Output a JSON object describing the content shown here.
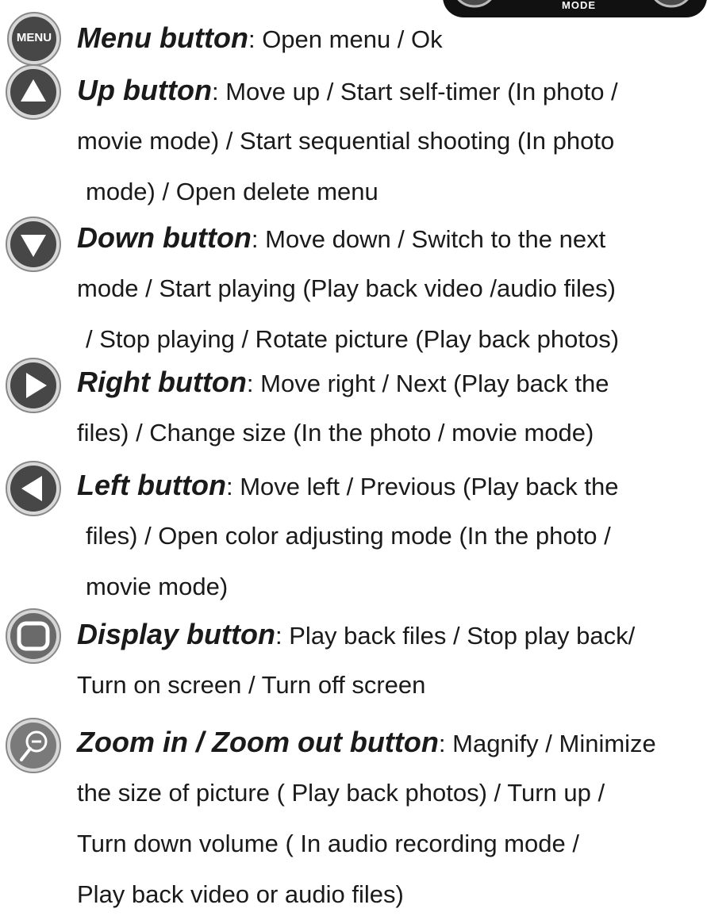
{
  "top_fragment": {
    "label": "MODE"
  },
  "entries": [
    {
      "icon": "menu-button-icon",
      "icon_text": "MENU",
      "title": "Menu button",
      "sep": ":",
      "lines": [
        "Open menu / Ok"
      ]
    },
    {
      "icon": "up-arrow-button-icon",
      "title": "Up button",
      "sep": ":",
      "lines": [
        "Move up / Start self-timer (In photo /",
        "movie mode) / Start sequential shooting (In photo",
        "mode) / Open delete menu"
      ]
    },
    {
      "icon": "down-arrow-button-icon",
      "title": "Down button",
      "sep": ":",
      "lines": [
        "Move down / Switch to the next",
        "mode / Start playing (Play back video /audio files)",
        "/ Stop playing / Rotate picture (Play back photos)"
      ]
    },
    {
      "icon": "right-arrow-button-icon",
      "title": "Right button",
      "sep": ":",
      "lines": [
        "Move right / Next (Play back the",
        "files) / Change size (In the photo / movie mode)"
      ]
    },
    {
      "icon": "left-arrow-button-icon",
      "title": "Left button",
      "sep": ":",
      "lines": [
        "Move left / Previous (Play back the",
        "files) / Open color adjusting mode (In the photo /",
        "movie mode)"
      ]
    },
    {
      "icon": "display-button-icon",
      "title": "Display button",
      "sep": ":",
      "lines": [
        "Play back files / Stop play back/",
        "Turn on screen / Turn off screen"
      ]
    },
    {
      "icon": "zoom-button-icon",
      "title": "Zoom in / Zoom out button",
      "sep": ":",
      "lines": [
        "Magnify / Minimize",
        "the size of picture ( Play back photos) / Turn up /",
        "Turn down volume ( In audio recording mode /",
        "Play back video or audio files)"
      ]
    }
  ]
}
